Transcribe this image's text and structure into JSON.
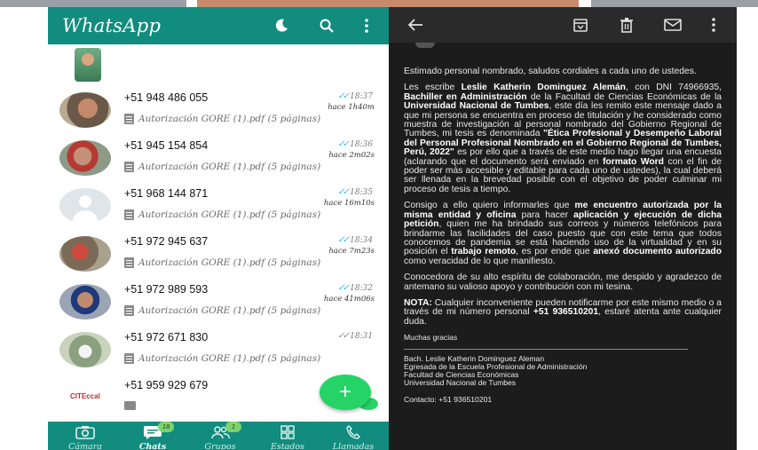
{
  "whatsapp": {
    "title": "WhatsApp",
    "chats": [
      {
        "name": "+51 948 486 055",
        "message": "Autorización GORE (1).pdf (5 páginas)",
        "time": "18:37",
        "ago": "hace 1h40m",
        "read": true
      },
      {
        "name": "+51 945 154 854",
        "message": "Autorización GORE (1).pdf (5 páginas)",
        "time": "18:36",
        "ago": "hace 2m02s",
        "read": true
      },
      {
        "name": "+51 968 144 871",
        "message": "Autorización GORE (1).pdf (5 páginas)",
        "time": "18:35",
        "ago": "hace 16m10s",
        "read": true
      },
      {
        "name": "+51 972 945 637",
        "message": "Autorización GORE (1).pdf (5 páginas)",
        "time": "18:34",
        "ago": "hace 7m23s",
        "read": true
      },
      {
        "name": "+51 972 989 593",
        "message": "Autorización GORE (1).pdf (5 páginas)",
        "time": "18:32",
        "ago": "hace 41m06s",
        "read": true
      },
      {
        "name": "+51 972 671 830",
        "message": "Autorización GORE (1).pdf (5 páginas)",
        "time": "18:31",
        "ago": "",
        "read": false
      },
      {
        "name": "+51 959 929 679",
        "message": "",
        "time": "",
        "ago": "",
        "read": false
      }
    ],
    "avatar_logo_text": "CITEccal",
    "fab_label": "+",
    "nav": {
      "camera": "Cámara",
      "chats": "Chats",
      "chats_badge": "18",
      "groups": "Grupos",
      "groups_badge": "1",
      "status": "Estados",
      "calls": "Llamadas"
    },
    "colors": {
      "header": "#128c7e",
      "fab": "#25d366",
      "read_ticks": "#34b7f1"
    }
  },
  "email": {
    "greeting": "Estimado personal nombrado, saludos cordiales a cada uno de ustedes.",
    "p1": {
      "a": "Les escribe ",
      "b": "Leslie Katherin Dominguez Alemán",
      "c": ", con DNI 74966935, ",
      "d": "Bachiller en Administración",
      "e": " de la Facultad de Ciencias Económicas de la ",
      "f": "Universidad Nacional de Tumbes",
      "g": ", este día les remito este mensaje dado a que mi persona se encuentra en proceso de titulación y he considerado como muestra de investigación al personal nombrado del Gobierno Regional de Tumbes, mi tesis es denominada ",
      "h": "\"Ética Profesional y Desempeño Laboral del Personal Profesional Nombrado en el Gobierno Regional de Tumbes, Perú, 2022\"",
      "i": " es por ello que a través de este medio hago llegar una encuesta (aclarando que el documento será enviado en ",
      "j": "formato Word",
      "k": " con el fin de poder ser más accesible y editable para cada uno de ustedes), la cual deberá ser llenada en la brevedad posible con el objetivo de poder culminar mi proceso de tesis a tiempo."
    },
    "p2": {
      "a": "Consigo a ello quiero informarles que ",
      "b": "me encuentro autorizada por la misma entidad y oficina",
      "c": " para hacer ",
      "d": "aplicación y ejecución de dicha petición",
      "e": ", quien me ha brindado sus correos y números telefónicos para brindarme las facilidades del caso puesto que con este tema que todos conocemos de pandemia se está haciendo uso de la virtualidad y en su posición el ",
      "f": "trabajo remoto",
      "g": ", es por ende que ",
      "h": "anexó documento autorizado",
      "i": " como veracidad de lo que manifiesto."
    },
    "p3": "Conocedora de su alto espíritu de colaboración, me despido y agradezco de antemano su valioso apoyo y contribución con mi tesina.",
    "p4": {
      "a": "NOTA:",
      "b": " Cualquier inconveniente pueden notificarme por este mismo medio o a través de mi número personal ",
      "c": "+51 936510201",
      "d": ", estaré atenta ante cualquier duda."
    },
    "closing": "Muchas gracias",
    "signature": [
      "Bach. Leslie Katherin Dominguez Aleman",
      "Egresada de la Escuela Profesional de Administración",
      "Facultad de Ciencias Económicas",
      "Universidad Nacional de Tumbes"
    ],
    "contact": "Contacto: +51 936510201",
    "colors": {
      "background": "#1c1c1c",
      "header": "#2a2a2a"
    }
  }
}
